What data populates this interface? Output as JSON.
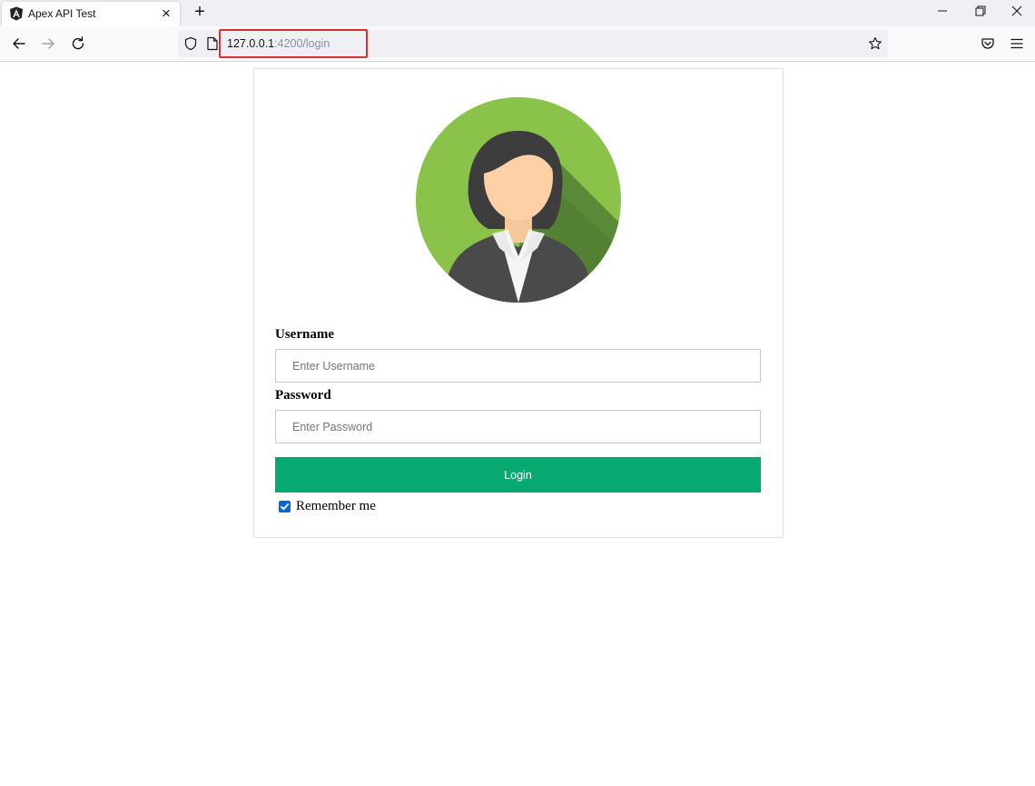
{
  "browser": {
    "tab": {
      "title": "Apex API Test",
      "favicon": "angular-logo-icon"
    },
    "url": {
      "host": "127.0.0.1",
      "rest": ":4200/login"
    }
  },
  "login": {
    "username_label": "Username",
    "username_placeholder": "Enter Username",
    "password_label": "Password",
    "password_placeholder": "Enter Password",
    "login_button": "Login",
    "remember_label": "Remember me",
    "remember_checked": true
  },
  "colors": {
    "login_button": "#06a96f",
    "avatar_background": "#8bc34a",
    "highlight_box": "#d9312e"
  }
}
